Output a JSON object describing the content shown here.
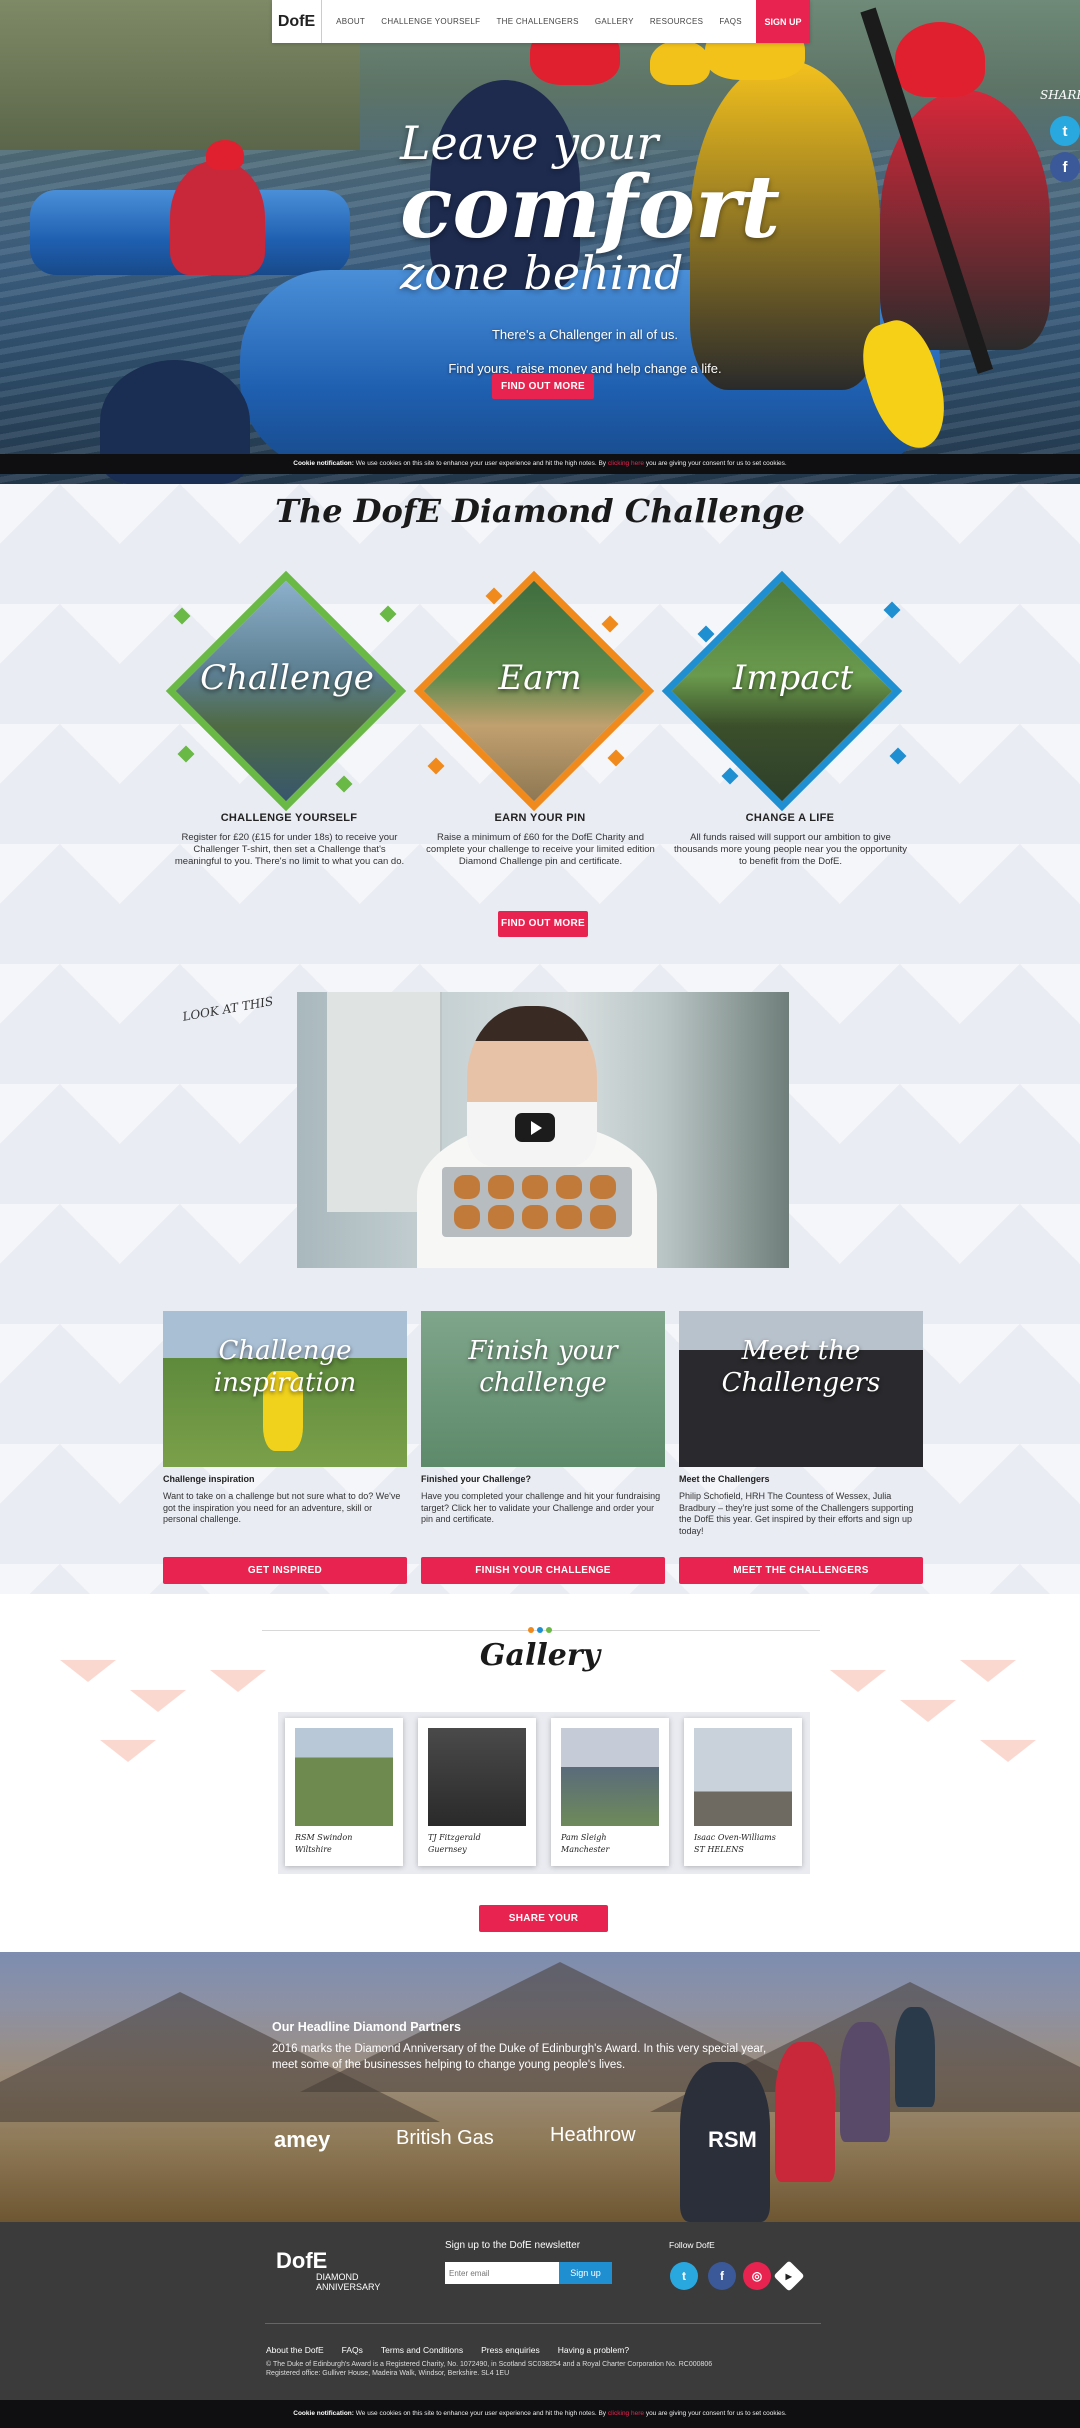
{
  "nav": {
    "logo": "DofE",
    "items": [
      "ABOUT",
      "CHALLENGE YOURSELF",
      "THE CHALLENGERS",
      "GALLERY",
      "RESOURCES",
      "FAQS"
    ],
    "signup": "SIGN UP"
  },
  "share": {
    "label": "SHARE",
    "twitter": "t",
    "facebook": "f"
  },
  "hero": {
    "line1": "Leave your",
    "line2": "comfort",
    "line3": "zone behind",
    "sub1": "There's a Challenger in all of us.",
    "sub2": "Find yours, raise money and help change a life.",
    "button": "FIND OUT MORE"
  },
  "cookie": {
    "label": "Cookie notification:",
    "text": "We use cookies on this site to enhance your user experience and hit the high notes. By",
    "link": "clicking here",
    "rest": "you are giving your consent for us to set cookies."
  },
  "dofe": {
    "title": "The DofE Diamond Challenge",
    "columns": [
      {
        "label": "Challenge",
        "title": "CHALLENGE YOURSELF",
        "body": "Register for £20 (£15 for under 18s) to receive your Challenger T-shirt, then set a Challenge that's meaningful to you. There's no limit to what you can do."
      },
      {
        "label": "Earn",
        "title": "EARN YOUR PIN",
        "body": "Raise a minimum of £60 for the DofE Charity and complete your challenge to receive your limited edition Diamond Challenge pin and certificate."
      },
      {
        "label": "Impact",
        "title": "CHANGE A LIFE",
        "body": "All funds raised will support our ambition to give thousands more young people near you the opportunity to benefit from the DofE."
      }
    ],
    "button": "FIND OUT MORE"
  },
  "video": {
    "look_label": "LOOK AT THIS"
  },
  "cards": [
    {
      "img_label": "Challenge inspiration",
      "title": "Challenge inspiration",
      "body": "Want to take on a challenge but not sure what to do? We've got the inspiration you need for an adventure, skill or personal challenge.",
      "button": "GET INSPIRED"
    },
    {
      "img_label": "Finish your challenge",
      "title": "Finished your Challenge?",
      "body": "Have you completed your challenge and hit your fundraising target? Click her to validate your Challenge and order your pin and certificate.",
      "button": "FINISH YOUR CHALLENGE"
    },
    {
      "img_label": "Meet the Challengers",
      "title": "Meet the Challengers",
      "body": "Philip Schofield, HRH The Countess of Wessex, Julia Bradbury – they're just some of the Challengers supporting the DofE this year. Get inspired by their efforts and sign up today!",
      "button": "MEET THE CHALLENGERS"
    }
  ],
  "gallery": {
    "title": "Gallery",
    "items": [
      {
        "line1": "RSM Swindon",
        "line2": "Wiltshire"
      },
      {
        "line1": "TJ Fitzgerald",
        "line2": "Guernsey"
      },
      {
        "line1": "Pam Sleigh",
        "line2": "Manchester"
      },
      {
        "line1": "Isaac Oven-Williams",
        "line2": "ST HELENS"
      }
    ],
    "button": "SHARE YOUR CHALLENGE"
  },
  "partners": {
    "title": "Our Headline Diamond Partners",
    "body": "2016 marks the Diamond Anniversary of the Duke of Edinburgh's Award. In this very special year, meet some of the businesses helping to change young people's lives.",
    "logos": [
      "amey",
      "British Gas",
      "Heathrow",
      "RSM"
    ]
  },
  "footer": {
    "logo_mark": "DofE",
    "logo_text": "DIAMOND ANNIVERSARY",
    "newsletter_title": "Sign up to the DofE newsletter",
    "email_placeholder": "Enter email",
    "signup_button": "Sign up",
    "follow_title": "Follow DofE",
    "links": [
      "About the DofE",
      "FAQs",
      "Terms and Conditions",
      "Press enquiries",
      "Having a problem?"
    ],
    "legal": "© The Duke of Edinburgh's Award is a Registered Charity, No. 1072490, in Scotland SC038254 and a Royal Charter Corporation No. RC000806",
    "address": "Registered office: Gulliver House, Madeira Walk, Windsor, Berkshire. SL4 1EU"
  },
  "colors": {
    "accent": "#e8234f",
    "green": "#6ab845",
    "orange": "#f08a1c",
    "blue": "#1f8fd1"
  }
}
